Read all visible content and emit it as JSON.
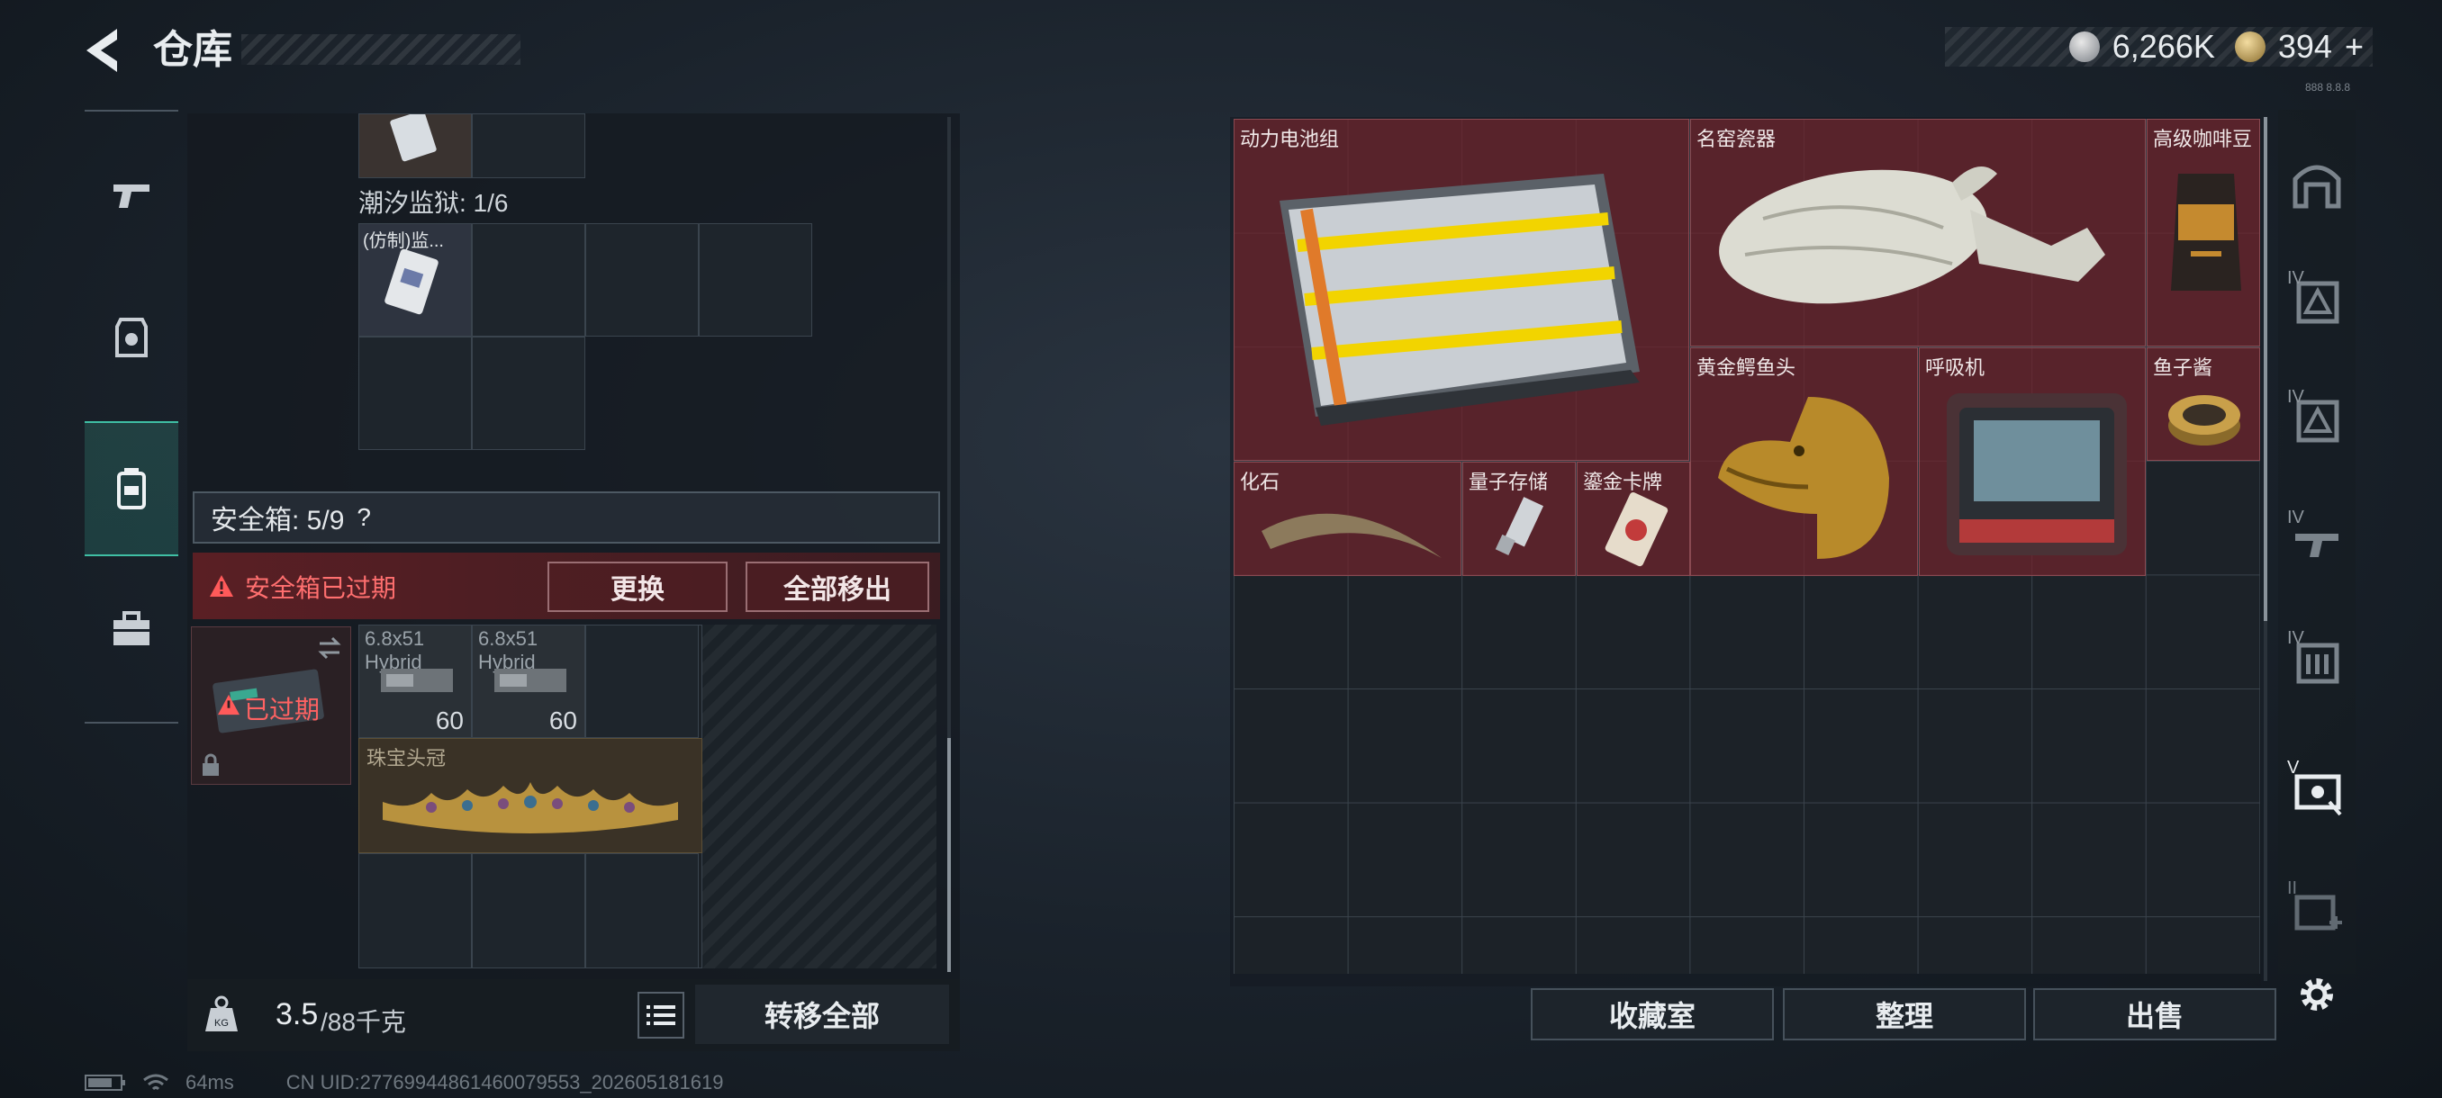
{
  "header": {
    "title": "仓库"
  },
  "currency": {
    "silver": "6,266K",
    "gold": "394",
    "plus": "+",
    "tiny": "888 8.8.8"
  },
  "left_nav": {
    "items": [
      "weapons",
      "armor",
      "backpack",
      "case"
    ]
  },
  "stash": {
    "prison_label": "潮汐监狱: 1/6",
    "imitation_item": "(仿制)监..."
  },
  "safe": {
    "title": "安全箱: 5/9",
    "help": "?",
    "warning": "安全箱已过期",
    "replace": "更换",
    "move_all_out": "全部移出",
    "expired": "已过期",
    "ammo": [
      {
        "name": "6.8x51",
        "type": "Hybrid",
        "count": "60"
      },
      {
        "name": "6.8x51",
        "type": "Hybrid",
        "count": "60"
      }
    ],
    "jewel_crown": "珠宝头冠"
  },
  "weight": {
    "current": "3.5",
    "max": "/88千克"
  },
  "transfer_all": "转移全部",
  "right_items": {
    "battery": "动力电池组",
    "porcelain": "名窑瓷器",
    "coffee": "高级咖啡豆",
    "crocodile": "黄金鳄鱼头",
    "respirator": "呼吸机",
    "caviar": "鱼子酱",
    "fossil": "化石",
    "quantum": "量子存储",
    "gold_card": "鎏金卡牌"
  },
  "bottom_buttons": {
    "collection": "收藏室",
    "sort": "整理",
    "sell": "出售"
  },
  "side_levels": [
    "IV",
    "IV",
    "IV",
    "IV",
    "V",
    "II"
  ],
  "status": {
    "ping": "64ms",
    "uid": "CN UID:27769944861460079553_202605181619"
  }
}
